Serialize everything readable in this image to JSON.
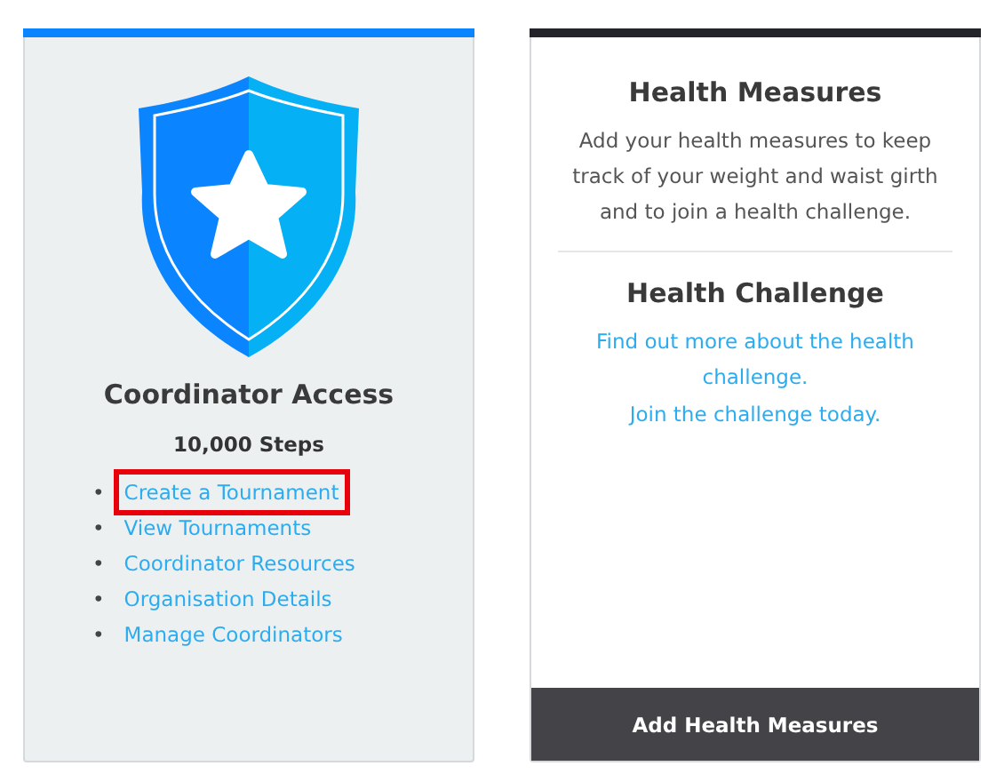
{
  "cards": [
    {
      "kind": "access",
      "color": "#0a84ff",
      "title": "Coordinator Access",
      "subtitle": "10,000 Steps",
      "links": [
        {
          "bullet": "•",
          "label": "Create a Tournament",
          "highlighted": true
        },
        {
          "bullet": "•",
          "label": "View Tournaments",
          "highlighted": false
        },
        {
          "bullet": "•",
          "label": "Coordinator Resources",
          "highlighted": false
        },
        {
          "bullet": "•",
          "label": "Organisation Details",
          "highlighted": false
        },
        {
          "bullet": "•",
          "label": "Manage Coordinators",
          "highlighted": false
        }
      ]
    },
    {
      "kind": "info",
      "color": "#222429",
      "sections": [
        {
          "heading": "Health Measures",
          "text": "Add your health measures to keep track of your weight and waist girth and to join a health challenge."
        },
        {
          "heading": "Health Challenge",
          "links": [
            "Find out more about the health challenge.",
            "Join the challenge today."
          ]
        }
      ],
      "button": "Add Health Measures"
    }
  ]
}
